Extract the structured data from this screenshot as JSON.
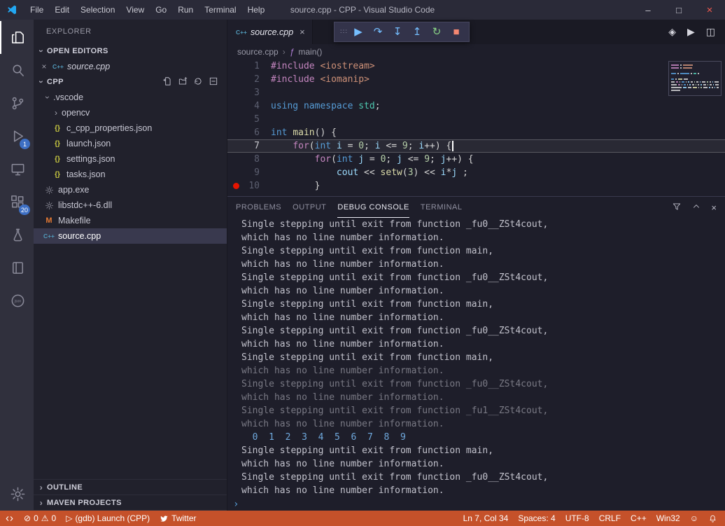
{
  "window": {
    "title": "source.cpp - CPP - Visual Studio Code"
  },
  "titlebar": {
    "menus": [
      "File",
      "Edit",
      "Selection",
      "View",
      "Go",
      "Run",
      "Terminal",
      "Help"
    ],
    "controls": [
      {
        "name": "minimize",
        "glyph": "–"
      },
      {
        "name": "maximize",
        "glyph": "□"
      },
      {
        "name": "close",
        "glyph": "×"
      }
    ]
  },
  "activity_bar": {
    "items": [
      {
        "name": "explorer",
        "icon": "files",
        "active": true
      },
      {
        "name": "search",
        "icon": "search"
      },
      {
        "name": "source-control",
        "icon": "git"
      },
      {
        "name": "run-and-debug",
        "icon": "debug",
        "badge": "1"
      },
      {
        "name": "remote-explorer",
        "icon": "monitor"
      },
      {
        "name": "extensions",
        "icon": "extensions",
        "badge": "20"
      },
      {
        "name": "testing",
        "icon": "flask"
      },
      {
        "name": "notebook",
        "icon": "book"
      },
      {
        "name": "json-tools",
        "icon": "json"
      }
    ],
    "bottom": [
      {
        "name": "settings",
        "icon": "gear"
      }
    ]
  },
  "sidebar": {
    "title": "EXPLORER",
    "open_editors": {
      "header": "OPEN EDITORS",
      "items": [
        {
          "label": "source.cpp",
          "icon": "cpp",
          "close": "×"
        }
      ]
    },
    "project": {
      "header": "CPP",
      "actions": [
        {
          "name": "new-file"
        },
        {
          "name": "new-folder"
        },
        {
          "name": "refresh"
        },
        {
          "name": "collapse-all"
        }
      ]
    },
    "tree": [
      {
        "label": ".vscode",
        "chevron": "down",
        "indent": 1
      },
      {
        "label": "opencv",
        "chevron": "right",
        "indent": 2
      },
      {
        "label": "c_cpp_properties.json",
        "icon": "json",
        "indent": 2
      },
      {
        "label": "launch.json",
        "icon": "json",
        "indent": 2
      },
      {
        "label": "settings.json",
        "icon": "json",
        "indent": 2
      },
      {
        "label": "tasks.json",
        "icon": "json",
        "indent": 2
      },
      {
        "label": "app.exe",
        "icon": "bin",
        "indent": 1
      },
      {
        "label": "libstdc++-6.dll",
        "icon": "bin",
        "indent": 1
      },
      {
        "label": "Makefile",
        "icon": "makefile",
        "indent": 1
      },
      {
        "label": "source.cpp",
        "icon": "cpp",
        "indent": 1,
        "selected": true
      }
    ],
    "bottom_sections": [
      {
        "label": "OUTLINE"
      },
      {
        "label": "MAVEN PROJECTS"
      }
    ]
  },
  "debug_toolbar": {
    "buttons": [
      {
        "name": "drag-handle",
        "glyph": "∷∷",
        "color": "#8a8aa0"
      },
      {
        "name": "continue",
        "glyph": "▶",
        "color": "#75beff"
      },
      {
        "name": "step-over",
        "glyph": "↷",
        "color": "#75beff"
      },
      {
        "name": "step-into",
        "glyph": "↧",
        "color": "#75beff"
      },
      {
        "name": "step-out",
        "glyph": "↥",
        "color": "#75beff"
      },
      {
        "name": "restart",
        "glyph": "↻",
        "color": "#89d185"
      },
      {
        "name": "stop",
        "glyph": "■",
        "color": "#f48771"
      }
    ]
  },
  "editor": {
    "tab": {
      "label": "source.cpp",
      "close": "×"
    },
    "actions": [
      {
        "name": "open-changes",
        "glyph": "◈"
      },
      {
        "name": "run",
        "glyph": "▶"
      },
      {
        "name": "split-editor",
        "glyph": "◫"
      }
    ],
    "breadcrumbs": {
      "file": "source.cpp",
      "separator": "›",
      "symbol_icon": "ƒ",
      "symbol": "main()"
    },
    "current_line": 7,
    "breakpoint_line": 10,
    "code_lines": [
      {
        "num": 1,
        "tokens": [
          [
            "pp",
            "#include"
          ],
          [
            "pl",
            " "
          ],
          [
            "inc",
            "<iostream>"
          ]
        ]
      },
      {
        "num": 2,
        "tokens": [
          [
            "pp",
            "#include"
          ],
          [
            "pl",
            " "
          ],
          [
            "inc",
            "<iomanip>"
          ]
        ]
      },
      {
        "num": 3,
        "tokens": []
      },
      {
        "num": 4,
        "tokens": [
          [
            "kw",
            "using"
          ],
          [
            "pl",
            " "
          ],
          [
            "kw",
            "namespace"
          ],
          [
            "pl",
            " "
          ],
          [
            "cls",
            "std"
          ],
          [
            "pl",
            ";"
          ]
        ]
      },
      {
        "num": 5,
        "tokens": []
      },
      {
        "num": 6,
        "tokens": [
          [
            "kw",
            "int"
          ],
          [
            "pl",
            " "
          ],
          [
            "fn",
            "main"
          ],
          [
            "pl",
            "() {"
          ]
        ]
      },
      {
        "num": 7,
        "tokens": [
          [
            "pl",
            "    "
          ],
          [
            "ctl",
            "for"
          ],
          [
            "pl",
            "("
          ],
          [
            "kw",
            "int"
          ],
          [
            "pl",
            " "
          ],
          [
            "var",
            "i"
          ],
          [
            "pl",
            " = "
          ],
          [
            "num",
            "0"
          ],
          [
            "pl",
            "; "
          ],
          [
            "var",
            "i"
          ],
          [
            "pl",
            " <= "
          ],
          [
            "num",
            "9"
          ],
          [
            "pl",
            "; "
          ],
          [
            "var",
            "i"
          ],
          [
            "pl",
            "++) {"
          ]
        ]
      },
      {
        "num": 8,
        "tokens": [
          [
            "pl",
            "        "
          ],
          [
            "ctl",
            "for"
          ],
          [
            "pl",
            "("
          ],
          [
            "kw",
            "int"
          ],
          [
            "pl",
            " "
          ],
          [
            "var",
            "j"
          ],
          [
            "pl",
            " = "
          ],
          [
            "num",
            "0"
          ],
          [
            "pl",
            "; "
          ],
          [
            "var",
            "j"
          ],
          [
            "pl",
            " <= "
          ],
          [
            "num",
            "9"
          ],
          [
            "pl",
            "; "
          ],
          [
            "var",
            "j"
          ],
          [
            "pl",
            "++) {"
          ]
        ]
      },
      {
        "num": 9,
        "tokens": [
          [
            "pl",
            "            "
          ],
          [
            "var",
            "cout"
          ],
          [
            "pl",
            " << "
          ],
          [
            "fn",
            "setw"
          ],
          [
            "pl",
            "("
          ],
          [
            "num",
            "3"
          ],
          [
            "pl",
            ") << "
          ],
          [
            "var",
            "i"
          ],
          [
            "pl",
            "*"
          ],
          [
            "var",
            "j"
          ],
          [
            "pl",
            " ;"
          ]
        ]
      },
      {
        "num": 10,
        "tokens": [
          [
            "pl",
            "        }"
          ]
        ]
      }
    ]
  },
  "panel": {
    "tabs": [
      {
        "label": "PROBLEMS"
      },
      {
        "label": "OUTPUT"
      },
      {
        "label": "DEBUG CONSOLE",
        "active": true
      },
      {
        "label": "TERMINAL"
      }
    ],
    "actions": [
      {
        "name": "filter"
      },
      {
        "name": "maximize-panel"
      },
      {
        "name": "close-panel"
      }
    ],
    "console_lines": [
      {
        "t": "Single stepping until exit from function _fu0__ZSt4cout,",
        "s": "n"
      },
      {
        "t": "which has no line number information.",
        "s": "n"
      },
      {
        "t": "Single stepping until exit from function main,",
        "s": "n"
      },
      {
        "t": "which has no line number information.",
        "s": "n"
      },
      {
        "t": "Single stepping until exit from function _fu0__ZSt4cout,",
        "s": "n"
      },
      {
        "t": "which has no line number information.",
        "s": "n"
      },
      {
        "t": "Single stepping until exit from function main,",
        "s": "n"
      },
      {
        "t": "which has no line number information.",
        "s": "n"
      },
      {
        "t": "Single stepping until exit from function _fu0__ZSt4cout,",
        "s": "n"
      },
      {
        "t": "which has no line number information.",
        "s": "n"
      },
      {
        "t": "Single stepping until exit from function main,",
        "s": "n"
      },
      {
        "t": "which has no line number information.",
        "s": "f"
      },
      {
        "t": "Single stepping until exit from function _fu0__ZSt4cout,",
        "s": "f"
      },
      {
        "t": "which has no line number information.",
        "s": "f"
      },
      {
        "t": "Single stepping until exit from function _fu1__ZSt4cout,",
        "s": "f"
      },
      {
        "t": "which has no line number information.",
        "s": "f"
      },
      {
        "t": "  0  1  2  3  4  5  6  7  8  9",
        "s": "o"
      },
      {
        "t": "Single stepping until exit from function main,",
        "s": "n"
      },
      {
        "t": "which has no line number information.",
        "s": "n"
      },
      {
        "t": "Single stepping until exit from function _fu0__ZSt4cout,",
        "s": "n"
      },
      {
        "t": "which has no line number information.",
        "s": "n"
      }
    ],
    "prompt": "›"
  },
  "status_bar": {
    "errors": "0",
    "warnings": "0",
    "launch_label": "(gdb) Launch (CPP)",
    "twitter_label": "Twitter",
    "right": [
      "Ln 7, Col 34",
      "Spaces: 4",
      "UTF-8",
      "CRLF",
      "C++",
      "Win32"
    ],
    "colors": {
      "background": "#c5512a",
      "badge": "#3d6fc4",
      "breakpoint": "#e51400"
    }
  }
}
